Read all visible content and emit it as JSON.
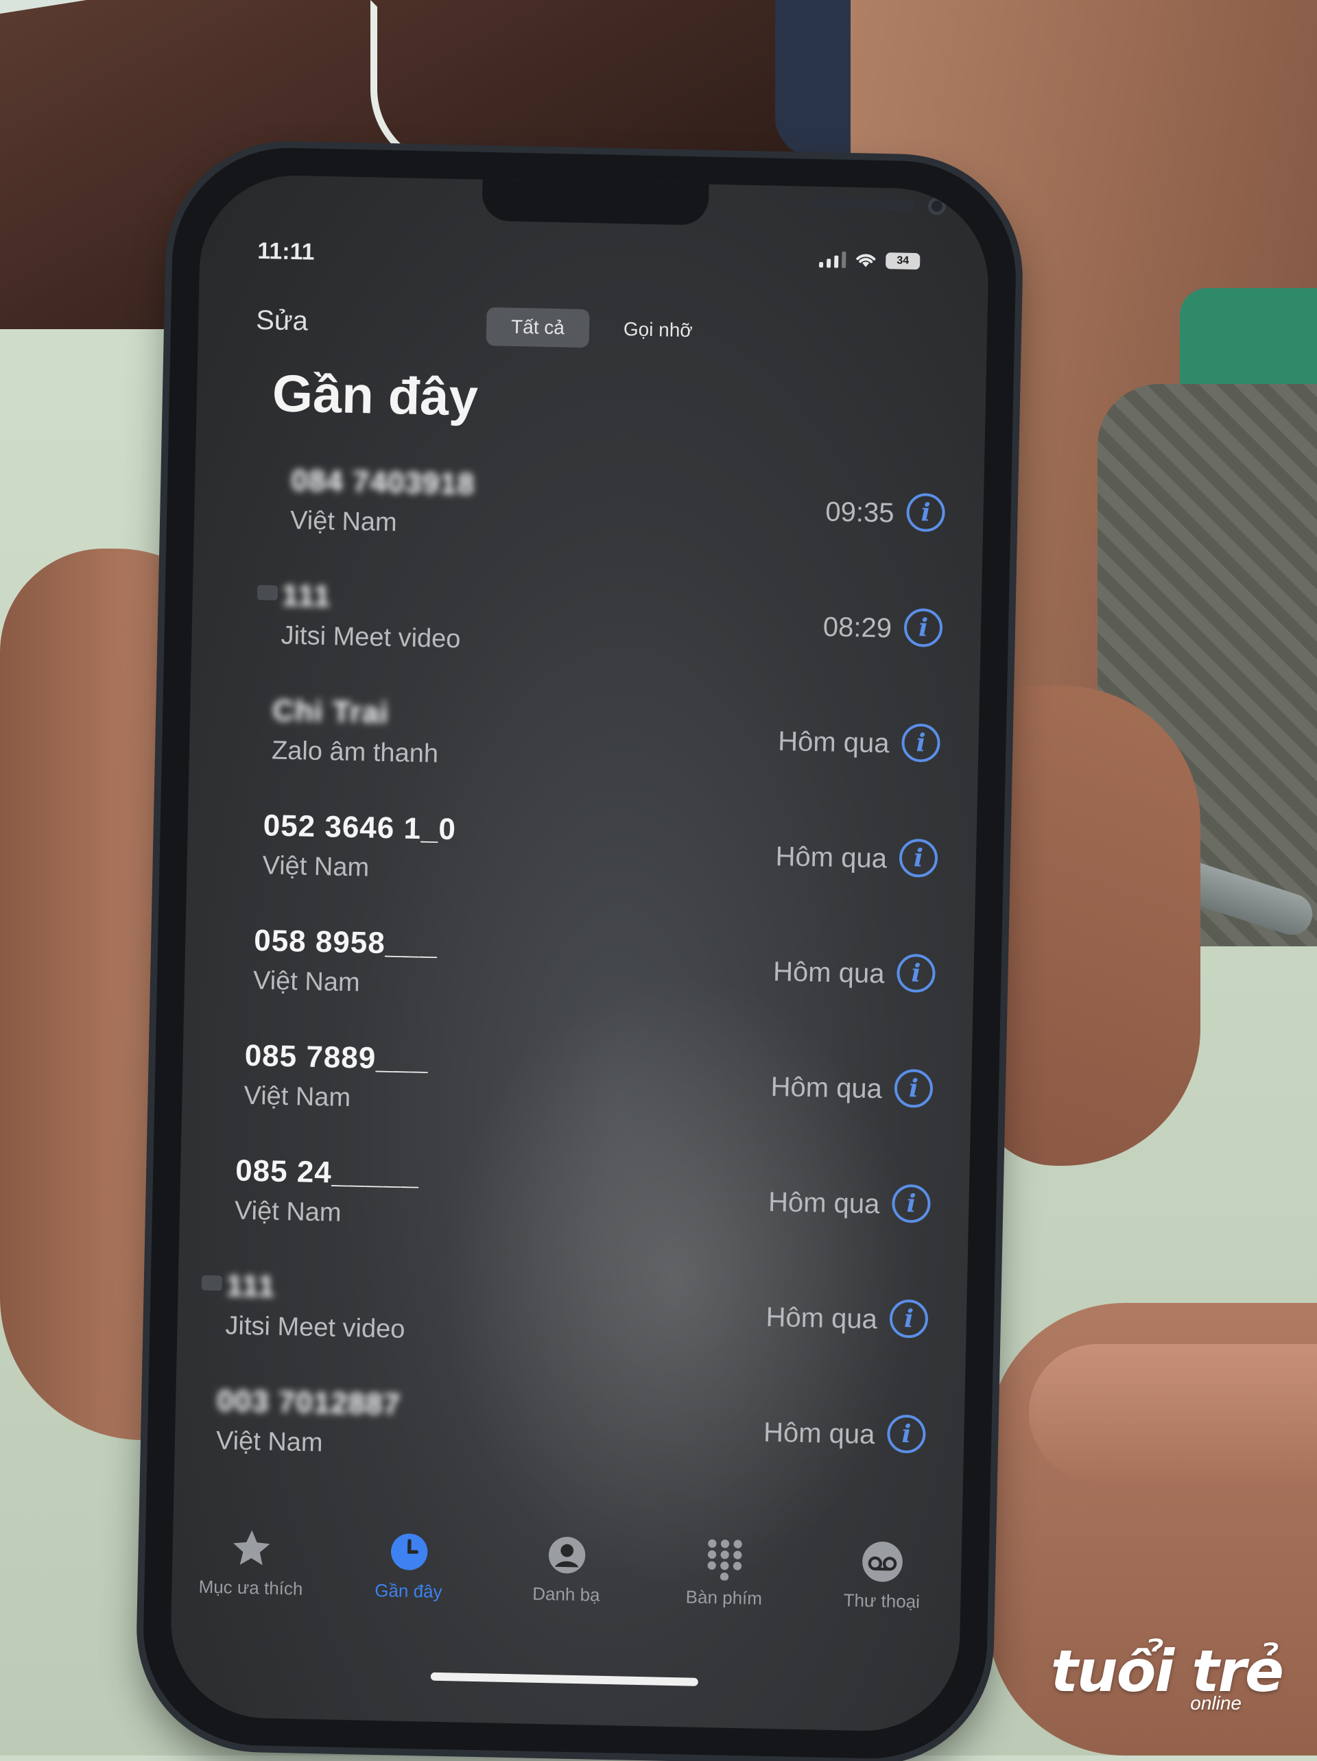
{
  "status_bar": {
    "time": "11:11",
    "battery": "34"
  },
  "nav": {
    "edit_label": "Sửa",
    "segments": [
      {
        "label": "Tất cả",
        "active": true
      },
      {
        "label": "Gọi nhỡ",
        "active": false
      }
    ],
    "title": "Gần đây"
  },
  "calls": [
    {
      "name": "084 7403918",
      "blurred": true,
      "subtitle": "Việt Nam",
      "time": "09:35",
      "video": false
    },
    {
      "name": "111",
      "blurred": true,
      "subtitle": "Jitsi Meet video",
      "time": "08:29",
      "video": true
    },
    {
      "name": "Chi Trai",
      "blurred": true,
      "subtitle": "Zalo âm thanh",
      "time": "Hôm qua",
      "video": false
    },
    {
      "name": "052 3646 1_0",
      "blurred": false,
      "subtitle": "Việt Nam",
      "time": "Hôm qua",
      "video": false
    },
    {
      "name": "058 8958___",
      "blurred": false,
      "subtitle": "Việt Nam",
      "time": "Hôm qua",
      "video": false
    },
    {
      "name": "085 7889___",
      "blurred": false,
      "subtitle": "Việt Nam",
      "time": "Hôm qua",
      "video": false
    },
    {
      "name": "085 24_____",
      "blurred": false,
      "subtitle": "Việt Nam",
      "time": "Hôm qua",
      "video": false
    },
    {
      "name": "111",
      "blurred": true,
      "subtitle": "Jitsi Meet video",
      "time": "Hôm qua",
      "video": true
    },
    {
      "name": "003 7012887",
      "blurred": true,
      "subtitle": "Việt Nam",
      "time": "Hôm qua",
      "video": false
    }
  ],
  "tabs": [
    {
      "label": "Mục ưa thích",
      "icon": "star-icon",
      "active": false
    },
    {
      "label": "Gần đây",
      "icon": "clock-icon",
      "active": true
    },
    {
      "label": "Danh bạ",
      "icon": "contact-icon",
      "active": false
    },
    {
      "label": "Bàn phím",
      "icon": "keypad-icon",
      "active": false
    },
    {
      "label": "Thư thoại",
      "icon": "voicemail-icon",
      "active": false
    }
  ],
  "colors": {
    "accent": "#3d82f0",
    "info_blue": "#5b8fe8",
    "screen_bg": "#35373a"
  }
}
